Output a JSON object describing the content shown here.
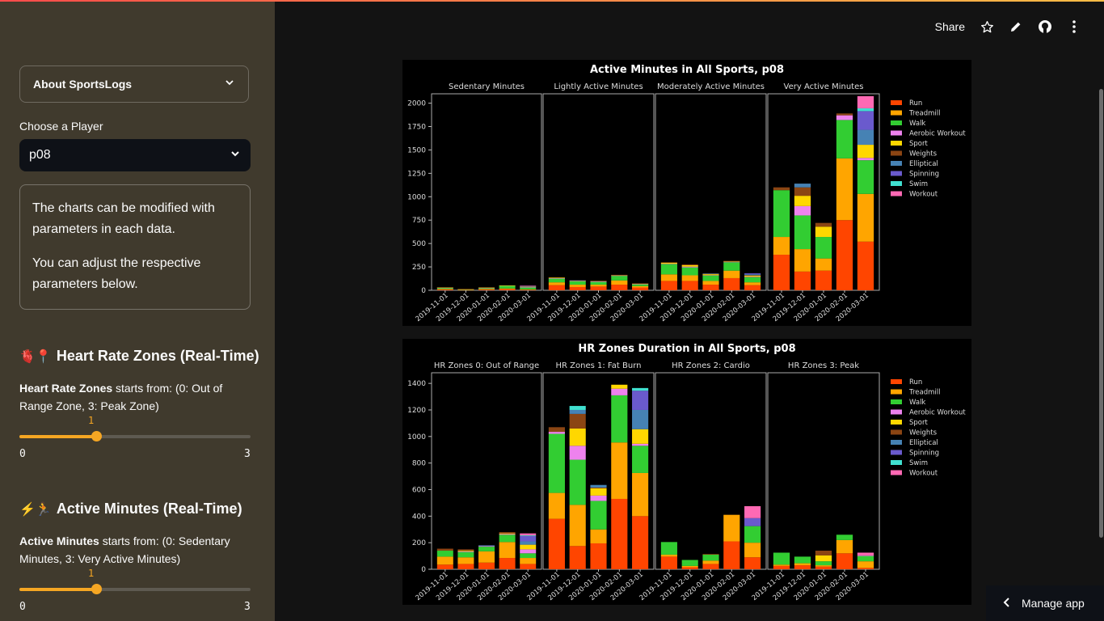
{
  "toolbar": {
    "share": "Share"
  },
  "sidebar": {
    "expander_label": "About SportsLogs",
    "player_label": "Choose a Player",
    "player_value": "p08",
    "info_line1": "The charts can be modified with parameters in each data.",
    "info_line2": "You can adjust the respective parameters below.",
    "hr_section": {
      "emoji": "🫀📍",
      "title": "Heart Rate Zones (Real-Time)",
      "desc_bold": "Heart Rate Zones",
      "desc_rest": " starts from: (0: Out of Range Zone, 3: Peak Zone)",
      "value": "1",
      "min": "0",
      "max": "3"
    },
    "am_section": {
      "emoji": "⚡🏃",
      "title": "Active Minutes (Real-Time)",
      "desc_bold": "Active Minutes",
      "desc_rest": " starts from: (0: Sedentary Minutes, 3: Very Active Minutes)",
      "value": "1",
      "min": "0",
      "max": "3"
    }
  },
  "manage_app": "Manage app",
  "colors": {
    "accent": "#f5a623"
  },
  "chart_data": [
    {
      "type": "bar",
      "stacked": true,
      "title": "Active Minutes in All Sports, p08",
      "panels": [
        "Sedentary Minutes",
        "Lightly Active Minutes",
        "Moderately Active Minutes",
        "Very Active Minutes"
      ],
      "categories": [
        "2019-11-01",
        "2019-12-01",
        "2020-01-01",
        "2020-02-01",
        "2020-03-01"
      ],
      "ylim": [
        0,
        2100
      ],
      "yticks": [
        0,
        250,
        500,
        750,
        1000,
        1250,
        1500,
        1750,
        2000
      ],
      "legend_position": "right",
      "series": [
        {
          "name": "Run",
          "color": "#ff4500",
          "values": [
            [
              8,
              3,
              8,
              12,
              6
            ],
            [
              55,
              35,
              40,
              60,
              30
            ],
            [
              100,
              100,
              60,
              130,
              55
            ],
            [
              380,
              200,
              210,
              750,
              520
            ]
          ]
        },
        {
          "name": "Treadmill",
          "color": "#ffa500",
          "values": [
            [
              6,
              2,
              6,
              8,
              4
            ],
            [
              30,
              25,
              20,
              45,
              15
            ],
            [
              70,
              60,
              40,
              80,
              30
            ],
            [
              190,
              240,
              130,
              660,
              510
            ]
          ]
        },
        {
          "name": "Walk",
          "color": "#32cd32",
          "values": [
            [
              12,
              6,
              10,
              30,
              20
            ],
            [
              40,
              35,
              30,
              50,
              20
            ],
            [
              110,
              85,
              60,
              90,
              55
            ],
            [
              500,
              360,
              230,
              410,
              360
            ]
          ]
        },
        {
          "name": "Aerobic Workout",
          "color": "#ee82ee",
          "values": [
            [
              2,
              1,
              3,
              1,
              4
            ],
            [
              5,
              5,
              5,
              3,
              2
            ],
            [
              4,
              8,
              2,
              5,
              5
            ],
            [
              0,
              100,
              0,
              50,
              25
            ]
          ]
        },
        {
          "name": "Sport",
          "color": "#ffd700",
          "values": [
            [
              3,
              1,
              3,
              1,
              5
            ],
            [
              5,
              2,
              4,
              5,
              5
            ],
            [
              10,
              15,
              10,
              5,
              12
            ],
            [
              0,
              110,
              110,
              0,
              140
            ]
          ]
        },
        {
          "name": "Weights",
          "color": "#8b4513",
          "values": [
            [
              1,
              1,
              2,
              0,
              2
            ],
            [
              4,
              2,
              2,
              2,
              2
            ],
            [
              5,
              8,
              4,
              4,
              4
            ],
            [
              30,
              90,
              40,
              20,
              0
            ]
          ]
        },
        {
          "name": "Elliptical",
          "color": "#4682b4",
          "values": [
            [
              0,
              0,
              0,
              0,
              2
            ],
            [
              0,
              2,
              0,
              0,
              0
            ],
            [
              0,
              0,
              5,
              0,
              10
            ],
            [
              0,
              40,
              0,
              0,
              160
            ]
          ]
        },
        {
          "name": "Spinning",
          "color": "#6a5acd",
          "values": [
            [
              0,
              0,
              0,
              0,
              3
            ],
            [
              0,
              0,
              0,
              0,
              0
            ],
            [
              0,
              0,
              0,
              0,
              10
            ],
            [
              0,
              0,
              0,
              0,
              200
            ]
          ]
        },
        {
          "name": "Swim",
          "color": "#40e0d0",
          "values": [
            [
              0,
              0,
              0,
              0,
              0
            ],
            [
              0,
              0,
              0,
              0,
              0
            ],
            [
              0,
              0,
              0,
              0,
              0
            ],
            [
              0,
              0,
              0,
              0,
              30
            ]
          ]
        },
        {
          "name": "Workout",
          "color": "#ff69b4",
          "values": [
            [
              0,
              0,
              0,
              0,
              4
            ],
            [
              0,
              0,
              0,
              0,
              0
            ],
            [
              0,
              0,
              0,
              0,
              0
            ],
            [
              0,
              0,
              0,
              0,
              130
            ]
          ]
        }
      ]
    },
    {
      "type": "bar",
      "stacked": true,
      "title": "HR Zones Duration in All Sports, p08",
      "panels": [
        "HR Zones 0: Out of Range",
        "HR Zones 1: Fat Burn",
        "HR Zones 2: Cardio",
        "HR Zones 3: Peak"
      ],
      "categories": [
        "2019-11-01",
        "2019-12-01",
        "2020-01-01",
        "2020-02-01",
        "2020-03-01"
      ],
      "ylim": [
        0,
        1480
      ],
      "yticks": [
        0,
        200,
        400,
        600,
        800,
        1000,
        1200,
        1400
      ],
      "legend_position": "right",
      "series": [
        {
          "name": "Run",
          "color": "#ff4500",
          "values": [
            [
              35,
              40,
              50,
              85,
              40
            ],
            [
              380,
              175,
              195,
              530,
              400
            ],
            [
              95,
              15,
              40,
              210,
              90
            ],
            [
              25,
              30,
              20,
              120,
              10
            ]
          ]
        },
        {
          "name": "Treadmill",
          "color": "#ffa500",
          "values": [
            [
              60,
              50,
              85,
              120,
              45
            ],
            [
              195,
              310,
              105,
              425,
              325
            ],
            [
              15,
              10,
              25,
              200,
              110
            ],
            [
              10,
              15,
              10,
              100,
              50
            ]
          ]
        },
        {
          "name": "Walk",
          "color": "#32cd32",
          "values": [
            [
              45,
              40,
              35,
              55,
              35
            ],
            [
              445,
              340,
              215,
              355,
              205
            ],
            [
              95,
              45,
              45,
              0,
              125
            ],
            [
              90,
              50,
              30,
              40,
              40
            ]
          ]
        },
        {
          "name": "Aerobic Workout",
          "color": "#ee82ee",
          "values": [
            [
              0,
              5,
              5,
              5,
              30
            ],
            [
              15,
              105,
              40,
              50,
              15
            ],
            [
              0,
              0,
              0,
              0,
              0
            ],
            [
              0,
              0,
              0,
              0,
              5
            ]
          ]
        },
        {
          "name": "Sport",
          "color": "#ffd700",
          "values": [
            [
              0,
              5,
              0,
              5,
              35
            ],
            [
              0,
              130,
              55,
              30,
              110
            ],
            [
              0,
              0,
              0,
              0,
              0
            ],
            [
              0,
              0,
              45,
              0,
              0
            ]
          ]
        },
        {
          "name": "Weights",
          "color": "#8b4513",
          "values": [
            [
              15,
              10,
              0,
              10,
              0
            ],
            [
              35,
              110,
              5,
              0,
              0
            ],
            [
              0,
              0,
              5,
              0,
              0
            ],
            [
              0,
              0,
              35,
              0,
              0
            ]
          ]
        },
        {
          "name": "Elliptical",
          "color": "#4682b4",
          "values": [
            [
              0,
              0,
              5,
              0,
              25
            ],
            [
              0,
              30,
              20,
              0,
              145
            ],
            [
              0,
              0,
              0,
              0,
              0
            ],
            [
              0,
              0,
              0,
              0,
              0
            ]
          ]
        },
        {
          "name": "Spinning",
          "color": "#6a5acd",
          "values": [
            [
              0,
              0,
              0,
              0,
              40
            ],
            [
              0,
              0,
              0,
              0,
              145
            ],
            [
              0,
              0,
              0,
              0,
              60
            ],
            [
              0,
              0,
              0,
              0,
              0
            ]
          ]
        },
        {
          "name": "Swim",
          "color": "#40e0d0",
          "values": [
            [
              0,
              0,
              0,
              0,
              5
            ],
            [
              0,
              30,
              0,
              0,
              20
            ],
            [
              0,
              0,
              0,
              0,
              0
            ],
            [
              0,
              0,
              0,
              0,
              0
            ]
          ]
        },
        {
          "name": "Workout",
          "color": "#ff69b4",
          "values": [
            [
              0,
              0,
              0,
              0,
              15
            ],
            [
              0,
              0,
              0,
              0,
              0
            ],
            [
              0,
              0,
              0,
              0,
              90
            ],
            [
              0,
              0,
              0,
              0,
              20
            ]
          ]
        }
      ]
    }
  ]
}
